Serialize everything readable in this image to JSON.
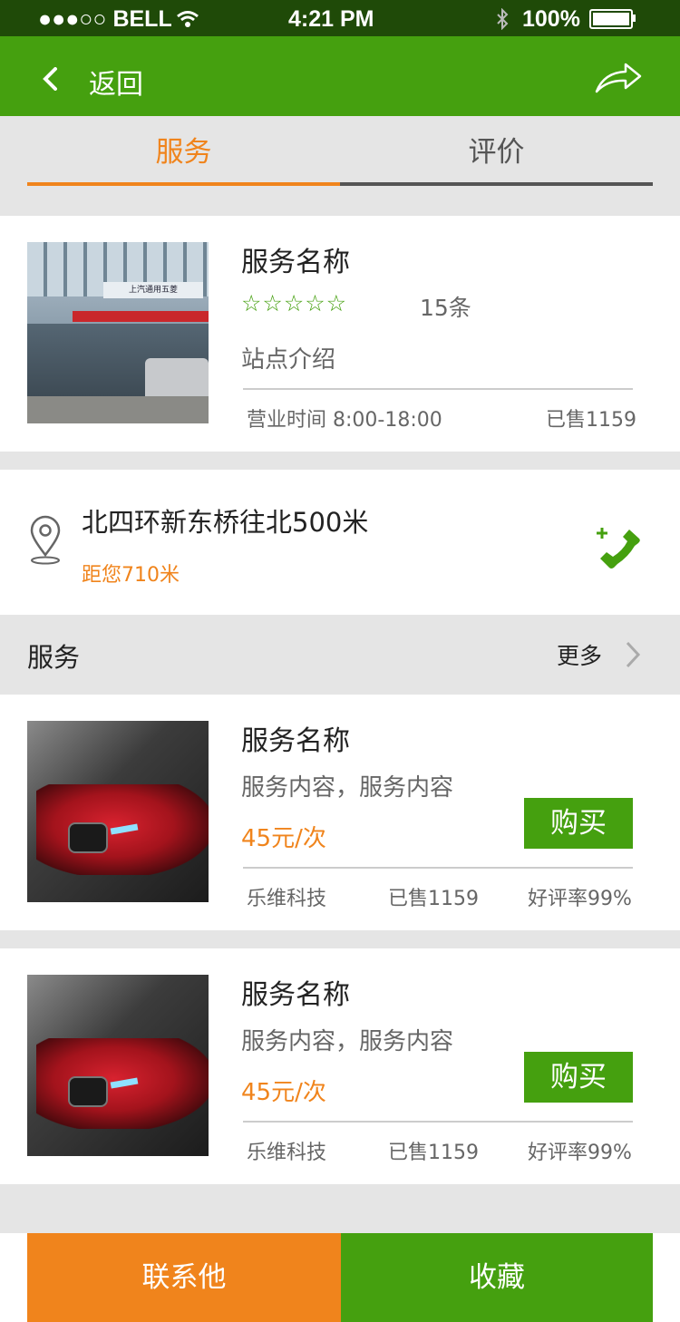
{
  "status_bar": {
    "carrier": "●●●○○ BELL",
    "time": "4:21 PM",
    "battery": "100%"
  },
  "nav": {
    "back_label": "返回"
  },
  "tabs": [
    {
      "label": "服务"
    },
    {
      "label": "评价"
    }
  ],
  "colors": {
    "green": "#45a00f",
    "orange": "#f0841c",
    "dark_status": "#1f4a08"
  },
  "shop": {
    "name": "服务名称",
    "stars": "☆☆☆☆☆",
    "review_count": "15条",
    "intro": "站点介绍",
    "hours": "营业时间 8:00-18:00",
    "sold": "已售1159",
    "image_sign": "上汽通用五菱"
  },
  "location": {
    "address": "北四环新东桥往北500米",
    "distance": "距您710米"
  },
  "services_section": {
    "title": "服务",
    "more": "更多"
  },
  "services": [
    {
      "name": "服务名称",
      "content": "服务内容，服务内容",
      "price": "45元/次",
      "buy": "购买",
      "vendor": "乐维科技",
      "sold": "已售1159",
      "rating": "好评率99%"
    },
    {
      "name": "服务名称",
      "content": "服务内容，服务内容",
      "price": "45元/次",
      "buy": "购买",
      "vendor": "乐维科技",
      "sold": "已售1159",
      "rating": "好评率99%"
    }
  ],
  "bottom": {
    "contact": "联系他",
    "favorite": "收藏"
  }
}
